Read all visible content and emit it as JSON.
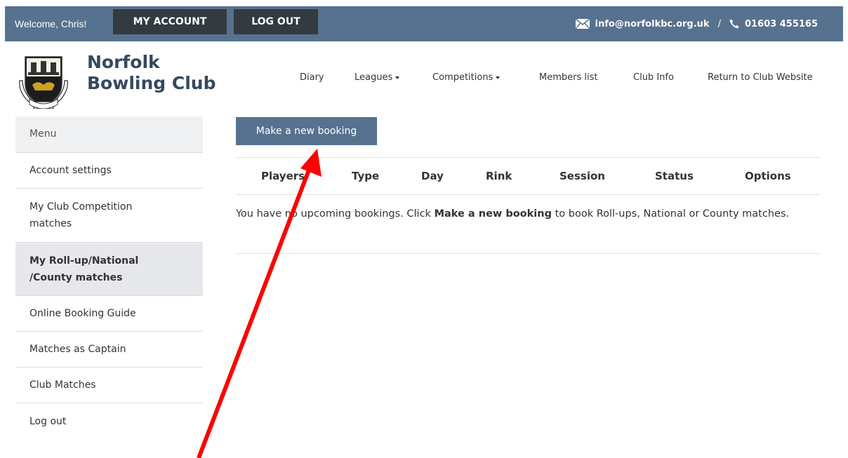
{
  "topbar": {
    "welcome": "Welcome, Chris!",
    "my_account": "MY ACCOUNT",
    "log_out": "LOG OUT",
    "email": "info@norfolkbc.org.uk",
    "separator": "/",
    "phone": "01603 455165"
  },
  "brand": {
    "line1": "Norfolk",
    "line2": "Bowling Club"
  },
  "nav": {
    "diary": "Diary",
    "leagues": "Leagues",
    "competitions": "Competitions",
    "members": "Members list",
    "club_info": "Club Info",
    "return": "Return to Club Website"
  },
  "sidebar": {
    "heading": "Menu",
    "items": [
      {
        "label": "Account settings"
      },
      {
        "label": "My Club Competition matches"
      },
      {
        "label": "My Roll-up/National /County matches"
      },
      {
        "label": "Online Booking Guide"
      },
      {
        "label": "Matches as Captain"
      },
      {
        "label": "Club Matches"
      },
      {
        "label": "Log out"
      }
    ]
  },
  "main": {
    "new_booking": "Make a new booking",
    "columns": [
      "Players",
      "Type",
      "Day",
      "Rink",
      "Session",
      "Status",
      "Options"
    ],
    "empty_pre": "You have no upcoming bookings. Click",
    "empty_bold": "Make a new booking",
    "empty_post": "to book Roll-ups, National or County matches."
  },
  "colors": {
    "topbar": "#56728f",
    "dark_button": "#333a40",
    "arrow": "#ff0000"
  }
}
